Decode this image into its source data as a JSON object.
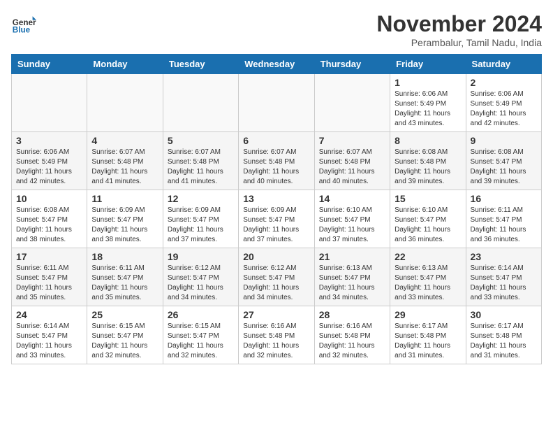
{
  "header": {
    "logo_line1": "General",
    "logo_line2": "Blue",
    "month_title": "November 2024",
    "location": "Perambalur, Tamil Nadu, India"
  },
  "days_of_week": [
    "Sunday",
    "Monday",
    "Tuesday",
    "Wednesday",
    "Thursday",
    "Friday",
    "Saturday"
  ],
  "weeks": [
    [
      {
        "day": "",
        "info": ""
      },
      {
        "day": "",
        "info": ""
      },
      {
        "day": "",
        "info": ""
      },
      {
        "day": "",
        "info": ""
      },
      {
        "day": "",
        "info": ""
      },
      {
        "day": "1",
        "info": "Sunrise: 6:06 AM\nSunset: 5:49 PM\nDaylight: 11 hours\nand 43 minutes."
      },
      {
        "day": "2",
        "info": "Sunrise: 6:06 AM\nSunset: 5:49 PM\nDaylight: 11 hours\nand 42 minutes."
      }
    ],
    [
      {
        "day": "3",
        "info": "Sunrise: 6:06 AM\nSunset: 5:49 PM\nDaylight: 11 hours\nand 42 minutes."
      },
      {
        "day": "4",
        "info": "Sunrise: 6:07 AM\nSunset: 5:48 PM\nDaylight: 11 hours\nand 41 minutes."
      },
      {
        "day": "5",
        "info": "Sunrise: 6:07 AM\nSunset: 5:48 PM\nDaylight: 11 hours\nand 41 minutes."
      },
      {
        "day": "6",
        "info": "Sunrise: 6:07 AM\nSunset: 5:48 PM\nDaylight: 11 hours\nand 40 minutes."
      },
      {
        "day": "7",
        "info": "Sunrise: 6:07 AM\nSunset: 5:48 PM\nDaylight: 11 hours\nand 40 minutes."
      },
      {
        "day": "8",
        "info": "Sunrise: 6:08 AM\nSunset: 5:48 PM\nDaylight: 11 hours\nand 39 minutes."
      },
      {
        "day": "9",
        "info": "Sunrise: 6:08 AM\nSunset: 5:47 PM\nDaylight: 11 hours\nand 39 minutes."
      }
    ],
    [
      {
        "day": "10",
        "info": "Sunrise: 6:08 AM\nSunset: 5:47 PM\nDaylight: 11 hours\nand 38 minutes."
      },
      {
        "day": "11",
        "info": "Sunrise: 6:09 AM\nSunset: 5:47 PM\nDaylight: 11 hours\nand 38 minutes."
      },
      {
        "day": "12",
        "info": "Sunrise: 6:09 AM\nSunset: 5:47 PM\nDaylight: 11 hours\nand 37 minutes."
      },
      {
        "day": "13",
        "info": "Sunrise: 6:09 AM\nSunset: 5:47 PM\nDaylight: 11 hours\nand 37 minutes."
      },
      {
        "day": "14",
        "info": "Sunrise: 6:10 AM\nSunset: 5:47 PM\nDaylight: 11 hours\nand 37 minutes."
      },
      {
        "day": "15",
        "info": "Sunrise: 6:10 AM\nSunset: 5:47 PM\nDaylight: 11 hours\nand 36 minutes."
      },
      {
        "day": "16",
        "info": "Sunrise: 6:11 AM\nSunset: 5:47 PM\nDaylight: 11 hours\nand 36 minutes."
      }
    ],
    [
      {
        "day": "17",
        "info": "Sunrise: 6:11 AM\nSunset: 5:47 PM\nDaylight: 11 hours\nand 35 minutes."
      },
      {
        "day": "18",
        "info": "Sunrise: 6:11 AM\nSunset: 5:47 PM\nDaylight: 11 hours\nand 35 minutes."
      },
      {
        "day": "19",
        "info": "Sunrise: 6:12 AM\nSunset: 5:47 PM\nDaylight: 11 hours\nand 34 minutes."
      },
      {
        "day": "20",
        "info": "Sunrise: 6:12 AM\nSunset: 5:47 PM\nDaylight: 11 hours\nand 34 minutes."
      },
      {
        "day": "21",
        "info": "Sunrise: 6:13 AM\nSunset: 5:47 PM\nDaylight: 11 hours\nand 34 minutes."
      },
      {
        "day": "22",
        "info": "Sunrise: 6:13 AM\nSunset: 5:47 PM\nDaylight: 11 hours\nand 33 minutes."
      },
      {
        "day": "23",
        "info": "Sunrise: 6:14 AM\nSunset: 5:47 PM\nDaylight: 11 hours\nand 33 minutes."
      }
    ],
    [
      {
        "day": "24",
        "info": "Sunrise: 6:14 AM\nSunset: 5:47 PM\nDaylight: 11 hours\nand 33 minutes."
      },
      {
        "day": "25",
        "info": "Sunrise: 6:15 AM\nSunset: 5:47 PM\nDaylight: 11 hours\nand 32 minutes."
      },
      {
        "day": "26",
        "info": "Sunrise: 6:15 AM\nSunset: 5:47 PM\nDaylight: 11 hours\nand 32 minutes."
      },
      {
        "day": "27",
        "info": "Sunrise: 6:16 AM\nSunset: 5:48 PM\nDaylight: 11 hours\nand 32 minutes."
      },
      {
        "day": "28",
        "info": "Sunrise: 6:16 AM\nSunset: 5:48 PM\nDaylight: 11 hours\nand 32 minutes."
      },
      {
        "day": "29",
        "info": "Sunrise: 6:17 AM\nSunset: 5:48 PM\nDaylight: 11 hours\nand 31 minutes."
      },
      {
        "day": "30",
        "info": "Sunrise: 6:17 AM\nSunset: 5:48 PM\nDaylight: 11 hours\nand 31 minutes."
      }
    ]
  ]
}
